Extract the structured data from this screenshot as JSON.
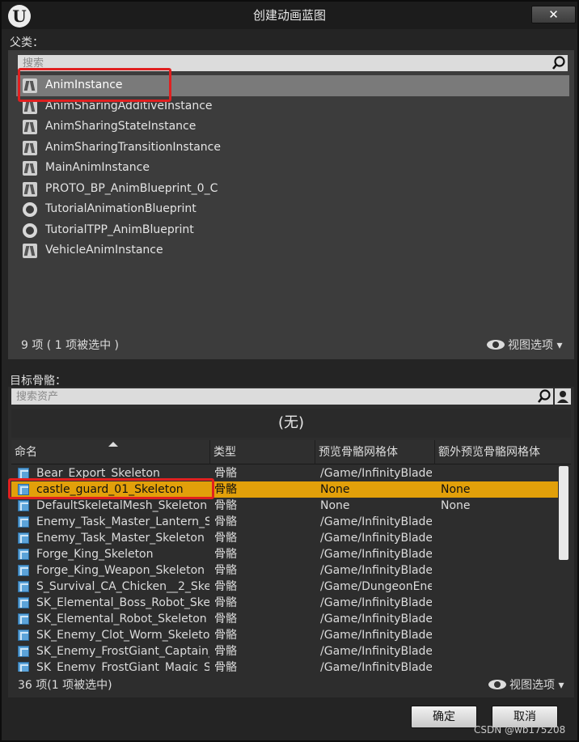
{
  "window": {
    "title": "创建动画蓝图",
    "close_label": "✕"
  },
  "parent_class": {
    "label": "父类：",
    "search": {
      "placeholder": "搜索",
      "value": ""
    },
    "items": [
      {
        "label": "AnimInstance",
        "icon": "anim-instance-icon",
        "selected": true
      },
      {
        "label": "AnimSharingAdditiveInstance",
        "icon": "anim-instance-icon"
      },
      {
        "label": "AnimSharingStateInstance",
        "icon": "anim-instance-icon"
      },
      {
        "label": "AnimSharingTransitionInstance",
        "icon": "anim-instance-icon"
      },
      {
        "label": "MainAnimInstance",
        "icon": "anim-instance-icon"
      },
      {
        "label": "PROTO_BP_AnimBlueprint_0_C",
        "icon": "anim-instance-icon"
      },
      {
        "label": "TutorialAnimationBlueprint",
        "icon": "blueprint-circle-icon"
      },
      {
        "label": "TutorialTPP_AnimBlueprint",
        "icon": "blueprint-circle-icon"
      },
      {
        "label": "VehicleAnimInstance",
        "icon": "anim-instance-icon"
      }
    ],
    "count_text": "9 项 ( 1 项被选中 )",
    "view_options": "视图选项"
  },
  "target_skeleton": {
    "label": "目标骨骼：",
    "search": {
      "placeholder": "搜索资产",
      "value": ""
    },
    "none_label": "(无)",
    "columns": [
      "命名",
      "类型",
      "预览骨骼网格体",
      "额外预览骨骼网格体"
    ],
    "rows": [
      {
        "name": "Bear_Export_Skeleton",
        "type": "骨骼",
        "preview": "/Game/InfinityBlade",
        "extra": ""
      },
      {
        "name": "castle_guard_01_Skeleton",
        "type": "骨骼",
        "preview": "None",
        "extra": "None",
        "selected": true
      },
      {
        "name": "DefaultSkeletalMesh_Skeleton",
        "type": "骨骼",
        "preview": "None",
        "extra": "None"
      },
      {
        "name": "Enemy_Task_Master_Lantern_S",
        "type": "骨骼",
        "preview": "/Game/InfinityBlade",
        "extra": ""
      },
      {
        "name": "Enemy_Task_Master_Skeleton",
        "type": "骨骼",
        "preview": "/Game/InfinityBlade",
        "extra": ""
      },
      {
        "name": "Forge_King_Skeleton",
        "type": "骨骼",
        "preview": "/Game/InfinityBlade",
        "extra": ""
      },
      {
        "name": "Forge_King_Weapon_Skeleton",
        "type": "骨骼",
        "preview": "/Game/InfinityBlade",
        "extra": ""
      },
      {
        "name": "S_Survival_CA_Chicken__2_Ske",
        "type": "骨骼",
        "preview": "/Game/DungeonEne",
        "extra": ""
      },
      {
        "name": "SK_Elemental_Boss_Robot_Ske",
        "type": "骨骼",
        "preview": "/Game/InfinityBlade",
        "extra": ""
      },
      {
        "name": "SK_Elemental_Robot_Skeleton",
        "type": "骨骼",
        "preview": "/Game/InfinityBlade",
        "extra": ""
      },
      {
        "name": "SK_Enemy_Clot_Worm_Skeletor",
        "type": "骨骼",
        "preview": "/Game/InfinityBlade",
        "extra": ""
      },
      {
        "name": "SK_Enemy_FrostGiant_Captain_",
        "type": "骨骼",
        "preview": "/Game/InfinityBlade",
        "extra": ""
      },
      {
        "name": "SK_Enemy_FrostGiant_Magic_S",
        "type": "骨骼",
        "preview": "/Game/InfinityBlade",
        "extra": ""
      }
    ],
    "count_text": "36 项(1 项被选中)",
    "view_options": "视图选项"
  },
  "buttons": {
    "ok": "确定",
    "cancel": "取消"
  },
  "watermark": "CSDN @wb175208",
  "colors": {
    "selection_orange": "#e2a00a",
    "highlight_red": "#e02020",
    "panel_bg": "#3c3c3c"
  }
}
